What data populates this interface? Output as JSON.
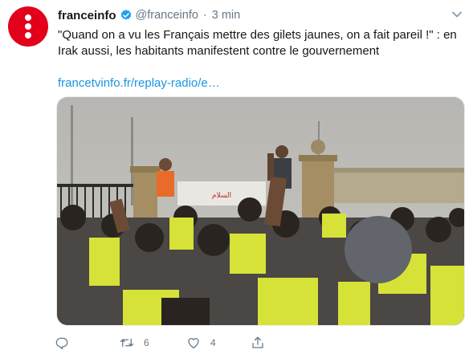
{
  "tweet": {
    "display_name": "franceinfo",
    "handle": "@franceinfo",
    "separator": "·",
    "timestamp": "3 min",
    "verified": true,
    "text": "\"Quand on a vu les Français mettre des gilets jaunes, on a fait pareil !\" : en Irak aussi, les habitants manifestent contre le gouvernement",
    "link": "francetvinfo.fr/replay-radio/e…",
    "media": {
      "type": "video-thumbnail",
      "sign_text": "السلام"
    },
    "actions": {
      "reply_count": "",
      "retweet_count": "6",
      "like_count": "4"
    }
  },
  "colors": {
    "brand_red": "#e2001a",
    "link_blue": "#1b95e0",
    "verified_blue": "#1da1f2",
    "muted_gray": "#657786"
  },
  "icons": [
    "franceinfo-logo-icon",
    "verified-badge-icon",
    "chevron-down-icon",
    "reply-icon",
    "retweet-icon",
    "like-icon",
    "share-icon"
  ]
}
